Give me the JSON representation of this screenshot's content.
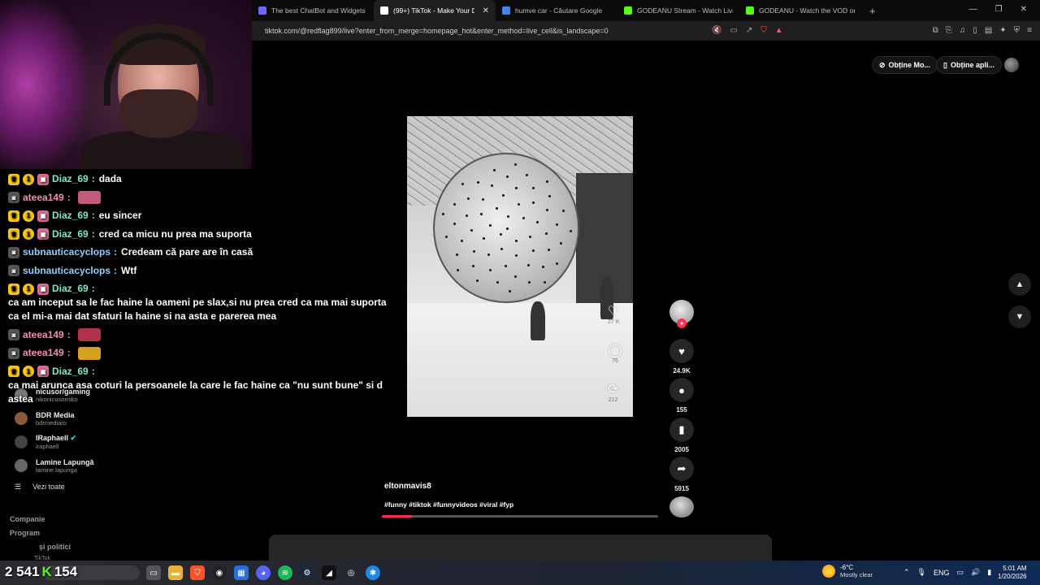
{
  "browser": {
    "tabs": [
      {
        "title": "The best ChatBot and Widgets for K",
        "color": "#6b6bff"
      },
      {
        "title": "(99+) TikTok - Make Your Day",
        "color": "#ffffff",
        "active": true
      },
      {
        "title": "humve car - Căutare Google",
        "color": "#4285f4"
      },
      {
        "title": "GODEANU Stream - Watch Live on Ki",
        "color": "#53fc18"
      },
      {
        "title": "GODEANU - Watch the VOD on Kick",
        "color": "#53fc18"
      }
    ],
    "new_tab": "+",
    "close_tab": "✕",
    "window_controls": {
      "minimize": "—",
      "maximize": "❐",
      "close": "✕"
    },
    "url": "tiktok.com/@redflag899/live?enter_from_merge=homepage_hot&enter_method=live_cell&is_landscape=0"
  },
  "tiktok": {
    "get_coins": "Obține Mo...",
    "get_app": "Obține apli...",
    "following": [
      {
        "name": "nicusor/gaming",
        "handle": "nikonicusorniko",
        "color": "#777"
      },
      {
        "name": "BDR Media",
        "handle": "bdrmediaro",
        "color": "#8a5a3a"
      },
      {
        "name": "IRaphaell",
        "handle": "iraphaell",
        "color": "#444",
        "verified": "✔"
      },
      {
        "name": "Lamine Lapungă",
        "handle": "lamine.lapunga",
        "color": "#666"
      }
    ],
    "see_all": "Vezi toate",
    "see_all_icon": "☰",
    "company": "Companie",
    "program": "Program",
    "policies": "și politici",
    "tiktok_label": "TikTok",
    "video": {
      "overlay_likes": "27 K",
      "overlay_comments": "76",
      "overlay_shares": "212"
    },
    "actions": {
      "likes": "24.9K",
      "comments": "155",
      "saves": "2005",
      "shares": "5915"
    },
    "caption_user": "eltonmavis8",
    "caption_tags": "#funny #tiktok #funnyvideos #viral #fyp",
    "progress_fraction": 0.11
  },
  "chat": [
    {
      "badges": [
        "crown",
        "coin",
        "gift"
      ],
      "user": "Diaz_69",
      "user_color": "#7ee8c8",
      "text": "dada"
    },
    {
      "badges": [
        "cam"
      ],
      "user": "ateea149",
      "user_color": "#f08fb0",
      "text": "",
      "emote": "#c45a7a"
    },
    {
      "badges": [
        "crown",
        "coin",
        "gift"
      ],
      "user": "Diaz_69",
      "user_color": "#7ee8c8",
      "text": "eu sincer"
    },
    {
      "badges": [
        "crown",
        "coin",
        "gift"
      ],
      "user": "Diaz_69",
      "user_color": "#7ee8c8",
      "text": "cred ca micu nu prea ma suporta"
    },
    {
      "badges": [
        "cam"
      ],
      "user": "subnauticacyclops",
      "user_color": "#8fd0ff",
      "text": "Credeam că pare are în casă"
    },
    {
      "badges": [
        "cam"
      ],
      "user": "subnauticacyclops",
      "user_color": "#8fd0ff",
      "text": "Wtf"
    },
    {
      "badges": [
        "crown",
        "coin",
        "gift"
      ],
      "user": "Diaz_69",
      "user_color": "#7ee8c8",
      "text": "ca am inceput sa le fac haine la oameni pe slax,si nu prea cred ca ma mai suporta ca el mi-a mai dat sfaturi la haine si na asta e parerea mea"
    },
    {
      "badges": [
        "cam"
      ],
      "user": "ateea149",
      "user_color": "#f08fb0",
      "text": "",
      "emote": "#b0304a"
    },
    {
      "badges": [
        "cam"
      ],
      "user": "ateea149",
      "user_color": "#f08fb0",
      "text": "",
      "emote": "#d4a020"
    },
    {
      "badges": [
        "crown",
        "coin",
        "gift"
      ],
      "user": "Diaz_69",
      "user_color": "#7ee8c8",
      "text": "ca mai arunca asa coturi la persoanele la care le fac haine ca \"nu sunt bune\" si d astea"
    }
  ],
  "stream": {
    "viewers": "2 541",
    "kick_icon": "K",
    "followers": "154"
  },
  "taskbar": {
    "temperature": "-6°C",
    "weather": "Mostly clear",
    "language": "ENG",
    "time": "5:01 AM",
    "date": "1/20/2026"
  }
}
